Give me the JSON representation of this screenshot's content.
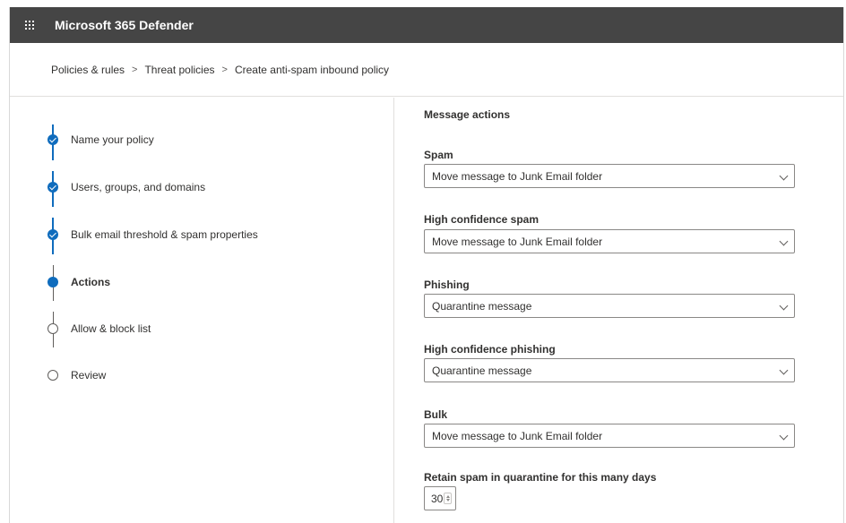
{
  "app": {
    "title": "Microsoft 365 Defender"
  },
  "breadcrumb": {
    "items": [
      "Policies & rules",
      "Threat policies",
      "Create anti-spam inbound policy"
    ],
    "separator": ">"
  },
  "wizard": {
    "steps": [
      {
        "label": "Name your policy",
        "status": "completed"
      },
      {
        "label": "Users, groups, and domains",
        "status": "completed"
      },
      {
        "label": "Bulk email threshold & spam properties",
        "status": "completed"
      },
      {
        "label": "Actions",
        "status": "current"
      },
      {
        "label": "Allow & block list",
        "status": "pending"
      },
      {
        "label": "Review",
        "status": "pending"
      }
    ]
  },
  "actions": {
    "section_title": "Message actions",
    "fields": [
      {
        "label": "Spam",
        "value": "Move message to Junk Email folder"
      },
      {
        "label": "High confidence spam",
        "value": "Move message to Junk Email folder"
      },
      {
        "label": "Phishing",
        "value": "Quarantine message"
      },
      {
        "label": "High confidence phishing",
        "value": "Quarantine message"
      },
      {
        "label": "Bulk",
        "value": "Move message to Junk Email folder"
      }
    ],
    "retention": {
      "label": "Retain spam in quarantine for this many days",
      "value": "30"
    }
  },
  "colors": {
    "accent": "#0f6cbd",
    "topbar": "#454545"
  },
  "icons": {
    "app_launcher": "waffle-icon",
    "step_done": "checkmark-circle-icon",
    "dropdown": "chevron-down-icon",
    "spin": "spin-arrows-icon"
  }
}
